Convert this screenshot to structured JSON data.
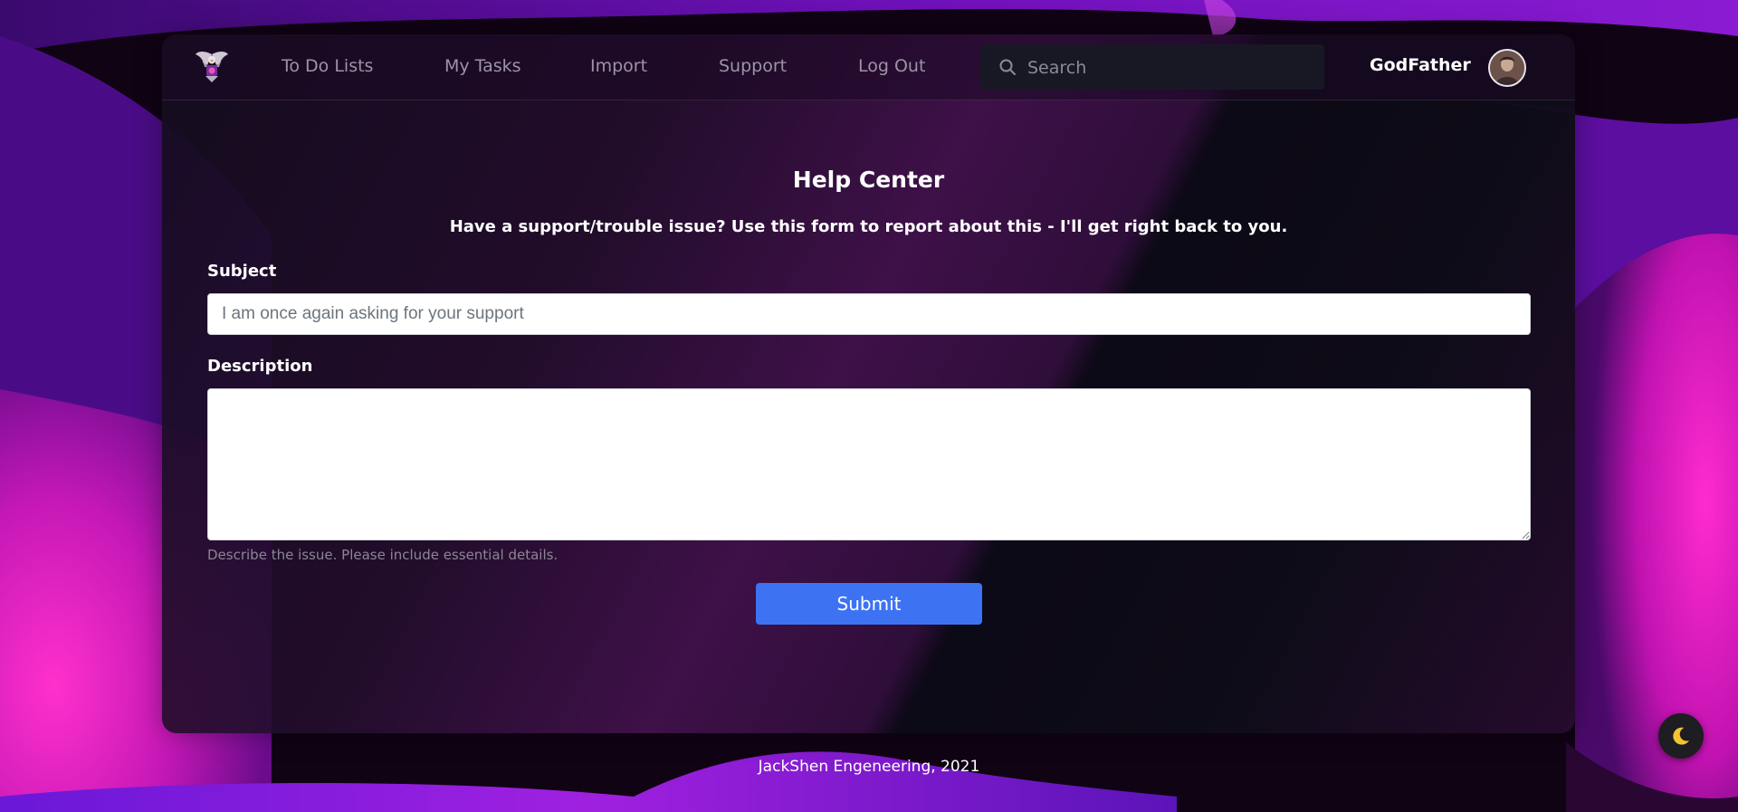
{
  "nav": {
    "links": [
      {
        "label": "To Do Lists"
      },
      {
        "label": "My Tasks"
      },
      {
        "label": "Import"
      },
      {
        "label": "Support"
      },
      {
        "label": "Log Out"
      }
    ],
    "search_placeholder": "Search",
    "username": "GodFather",
    "logo_icon": "eagle-logo-icon",
    "avatar_icon": "user-avatar"
  },
  "main": {
    "title": "Help Center",
    "subtitle": "Have a support/trouble issue? Use this form to report about this - I'll get right back to you.",
    "subject_label": "Subject",
    "subject_placeholder": "I am once again asking for your support",
    "subject_value": "",
    "description_label": "Description",
    "description_value": "",
    "help_text": "Describe the issue. Please include essential details.",
    "submit_label": "Submit"
  },
  "footer": {
    "text": "JackShen Engeneering, 2021"
  },
  "theme_toggle": {
    "icon": "moon-icon"
  },
  "colors": {
    "accent": "#3d73f2",
    "moon": "#f4c430",
    "background_magenta": "#ff2bd0",
    "background_purple": "#5a0fa8"
  }
}
